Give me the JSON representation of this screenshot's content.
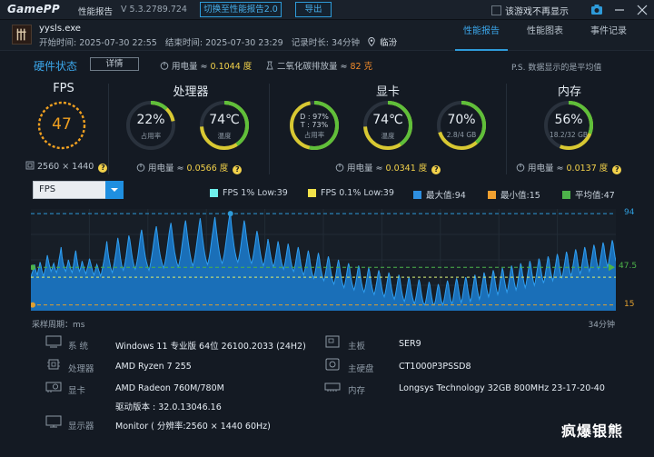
{
  "titlebar": {
    "logo": "GamePP",
    "report_label": "性能报告",
    "version": "V 5.3.2789.724",
    "switch_button": "切换至性能报告2.0",
    "export_button": "导出",
    "no_show_label": "该游戏不再显示"
  },
  "session": {
    "process": "yysls.exe",
    "start": "开始时间: 2025-07-30 22:55",
    "end": "结束时间: 2025-07-30 23:29",
    "duration": "记录时长: 34分钟",
    "location": "临汾"
  },
  "tabs": [
    {
      "label": "性能报告",
      "active": true
    },
    {
      "label": "性能图表",
      "active": false
    },
    {
      "label": "事件记录",
      "active": false
    }
  ],
  "hardware": {
    "title": "硬件状态",
    "detail_button": "详情",
    "power_label": "用电量 ≈",
    "power_value": "0.1044 度",
    "co2_label": "二氧化碳排放量 ≈",
    "co2_value": "82 克",
    "note": "P.S. 数据显示的是平均值"
  },
  "fps_panel": {
    "title": "FPS",
    "value": "47",
    "resolution": "2560 × 1440"
  },
  "cpu_panel": {
    "title": "处理器",
    "usage_value": "22%",
    "usage_label": "占用率",
    "usage_fraction": 0.22,
    "temp_value": "74℃",
    "temp_label": "温度",
    "temp_fraction": 0.74,
    "power_label": "用电量 ≈",
    "power_value": "0.0566 度"
  },
  "gpu_panel": {
    "title": "显卡",
    "d_usage": "D : 97%",
    "t_usage": "T : 73%",
    "usage_label": "占用率",
    "usage_fraction": 0.97,
    "temp_value": "74℃",
    "temp_label": "温度",
    "temp_fraction": 0.74,
    "vram_value": "70%",
    "vram_label": "2.8/4 GB",
    "vram_fraction": 0.7,
    "power_label": "用电量 ≈",
    "power_value": "0.0341 度"
  },
  "mem_panel": {
    "title": "内存",
    "usage_value": "56%",
    "usage_label": "18.2/32 GB",
    "usage_fraction": 0.56,
    "power_label": "用电量 ≈",
    "power_value": "0.0137 度"
  },
  "chart_controls": {
    "selected_metric": "FPS"
  },
  "chart_data": {
    "type": "area",
    "title": "",
    "series": [
      {
        "name": "FPS",
        "values": [
          39,
          42,
          44,
          47,
          50,
          46,
          43,
          41,
          45,
          48,
          52,
          49,
          45,
          42,
          40,
          44,
          47,
          53,
          58,
          54,
          50,
          47,
          44,
          46,
          49,
          51,
          48,
          45,
          43,
          46,
          50,
          55,
          60,
          65,
          57,
          52,
          49,
          46,
          44,
          47,
          50,
          54,
          51,
          48,
          45,
          43,
          47,
          52,
          58,
          62,
          56,
          51,
          47,
          44,
          46,
          49,
          53,
          50,
          47,
          44,
          42,
          45,
          48,
          51,
          55,
          52,
          49,
          46,
          43,
          41,
          44,
          47,
          50,
          48,
          45,
          43,
          40,
          42,
          46,
          50,
          54,
          59,
          64,
          70,
          62,
          56,
          52,
          48,
          45,
          43,
          47,
          51,
          56,
          61,
          67,
          73,
          68,
          61,
          55,
          50,
          47,
          45,
          48,
          52,
          57,
          63,
          69,
          75,
          72,
          66,
          60,
          55,
          51,
          48,
          46,
          49,
          53,
          58,
          64,
          70,
          76,
          80,
          74,
          68,
          62,
          57,
          53,
          50,
          47,
          45,
          48,
          52,
          57,
          62,
          68,
          74,
          79,
          83,
          77,
          70,
          64,
          59,
          55,
          52,
          49,
          47,
          50,
          54,
          59,
          65,
          71,
          77,
          82,
          86,
          80,
          73,
          67,
          61,
          57,
          53,
          50,
          48,
          51,
          55,
          60,
          66,
          72,
          78,
          84,
          88,
          82,
          75,
          69,
          63,
          58,
          54,
          51,
          49,
          52,
          56,
          61,
          67,
          73,
          79,
          85,
          90,
          83,
          76,
          70,
          64,
          59,
          55,
          52,
          50,
          53,
          57,
          62,
          68,
          74,
          80,
          86,
          91,
          84,
          77,
          71,
          65,
          60,
          56,
          53,
          51,
          54,
          58,
          63,
          69,
          75,
          81,
          87,
          92,
          94,
          85,
          78,
          72,
          66,
          61,
          57,
          54,
          52,
          55,
          59,
          64,
          70,
          76,
          82,
          88,
          84,
          77,
          71,
          65,
          60,
          56,
          53,
          51,
          54,
          58,
          63,
          68,
          74,
          79,
          75,
          69,
          63,
          58,
          54,
          51,
          49,
          52,
          56,
          61,
          66,
          72,
          68,
          62,
          57,
          53,
          50,
          48,
          51,
          55,
          60,
          65,
          70,
          66,
          60,
          55,
          51,
          48,
          46,
          49,
          53,
          58,
          63,
          68,
          64,
          58,
          53,
          49,
          46,
          44,
          47,
          51,
          56,
          61,
          65,
          61,
          55,
          50,
          46,
          43,
          41,
          44,
          48,
          53,
          58,
          62,
          58,
          52,
          47,
          43,
          40,
          38,
          41,
          45,
          50,
          55,
          60,
          56,
          50,
          45,
          41,
          38,
          36,
          39,
          43,
          48,
          53,
          57,
          53,
          47,
          42,
          38,
          35,
          33,
          36,
          40,
          45,
          50,
          54,
          50,
          44,
          39,
          35,
          32,
          30,
          33,
          37,
          42,
          47,
          51,
          48,
          42,
          37,
          33,
          30,
          28,
          31,
          35,
          40,
          45,
          49,
          46,
          40,
          35,
          31,
          28,
          26,
          29,
          33,
          38,
          43,
          47,
          44,
          38,
          33,
          29,
          26,
          24,
          27,
          31,
          36,
          41,
          45,
          42,
          36,
          31,
          27,
          24,
          22,
          25,
          29,
          34,
          39,
          43,
          40,
          34,
          29,
          25,
          22,
          20,
          23,
          27,
          32,
          37,
          41,
          38,
          32,
          27,
          23,
          20,
          18,
          21,
          25,
          30,
          35,
          39,
          36,
          30,
          25,
          21,
          18,
          16,
          19,
          23,
          28,
          33,
          37,
          34,
          28,
          23,
          19,
          16,
          15,
          17,
          21,
          26,
          31,
          35,
          32,
          26,
          21,
          17,
          15,
          16,
          19,
          24,
          29,
          33,
          30,
          25,
          20,
          17,
          15,
          18,
          22,
          27,
          32,
          36,
          33,
          27,
          22,
          18,
          16,
          19,
          24,
          29,
          34,
          38,
          35,
          29,
          24,
          20,
          17,
          20,
          25,
          30,
          35,
          39,
          36,
          30,
          25,
          21,
          18,
          21,
          26,
          31,
          36,
          41,
          38,
          32,
          27,
          23,
          20,
          23,
          28,
          33,
          38,
          43,
          40,
          34,
          29,
          25,
          22,
          25,
          30,
          35,
          40,
          45,
          42,
          36,
          31,
          27,
          24,
          27,
          32,
          37,
          42,
          47,
          44,
          38,
          33,
          29,
          26,
          29,
          34,
          39,
          44,
          49,
          46,
          40,
          35,
          31,
          28,
          31,
          36,
          41,
          46,
          51,
          48,
          42,
          37,
          33,
          30,
          33,
          38,
          43,
          48,
          53,
          50,
          44,
          39,
          35,
          32,
          35,
          40,
          45,
          50,
          55,
          52,
          46,
          41,
          37,
          34,
          37,
          42,
          47,
          52,
          57,
          54,
          48,
          43,
          39,
          36,
          39,
          44,
          49,
          54,
          59,
          56,
          50,
          45,
          41,
          38,
          41,
          46,
          51,
          56,
          61,
          58,
          52,
          47,
          43,
          40,
          43,
          48,
          53,
          58,
          63,
          60,
          54,
          49,
          45,
          42,
          45,
          50,
          55,
          60,
          65,
          62,
          56,
          51,
          47,
          44,
          47,
          52,
          57,
          62,
          67,
          64,
          58,
          53,
          49,
          46,
          49,
          54,
          59,
          64,
          69,
          66,
          60,
          55,
          51,
          48,
          51,
          56,
          61,
          66,
          71,
          68,
          62,
          57,
          53
        ]
      }
    ],
    "ylim": [
      10,
      98
    ],
    "reference_lines": [
      {
        "name": "最大值",
        "value": 94,
        "label": "94",
        "color": "#2e9bd9"
      },
      {
        "name": "平均值",
        "value": 47.5,
        "label": "47.5",
        "color": "#4db34a"
      },
      {
        "name": "最小值",
        "value": 15,
        "label": "15",
        "color": "#e0a030"
      },
      {
        "name": "FPS 1% Low",
        "value": 39,
        "color": "#6ff0ec"
      },
      {
        "name": "FPS 0.1% Low",
        "value": 39,
        "color": "#f2e24a"
      }
    ],
    "legend": [
      {
        "label": "FPS 1% Low:39",
        "color": "#6ff0ec"
      },
      {
        "label": "FPS 0.1% Low:39",
        "color": "#f2e24a"
      },
      {
        "label": "最大值:94",
        "color": "#2e8fe0"
      },
      {
        "label": "最小值:15",
        "color": "#f0a030"
      },
      {
        "label": "平均值:47",
        "color": "#4db34a"
      }
    ],
    "x_start_label": "采样周期：ms",
    "x_end_label": "34分钟",
    "grid": true,
    "legend_position": "top"
  },
  "system_info": [
    {
      "key": "系  统",
      "value": "Windows 11 专业版 64位 26100.2033 (24H2)",
      "icon": "monitor-os-icon"
    },
    {
      "key": "处理器",
      "value": "AMD Ryzen 7 255",
      "icon": "cpu-icon"
    },
    {
      "key": "显卡",
      "value": "AMD Radeon 760M/780M",
      "icon": "gpu-icon"
    },
    {
      "key": "",
      "value": "驱动版本 : 32.0.13046.16",
      "icon": ""
    },
    {
      "key": "显示器",
      "value": "Monitor ( 分辨率:2560 × 1440 60Hz)",
      "icon": "display-icon"
    },
    {
      "key": "主板",
      "value": "SER9",
      "icon": "motherboard-icon"
    },
    {
      "key": "主硬盘",
      "value": "CT1000P3PSSD8",
      "icon": "disk-icon"
    },
    {
      "key": "内存",
      "value": "Longsys Technology 32GB 800MHz 23-17-20-40",
      "icon": "memory-icon"
    }
  ],
  "watermark": "疯爆银熊",
  "colors": {
    "accent": "#2e9bd9",
    "fps_ring": "#f0a020",
    "gauge_green": "#5fbf3a",
    "gauge_yellow": "#d8c832",
    "chart_fill": "#1d7fd0"
  }
}
